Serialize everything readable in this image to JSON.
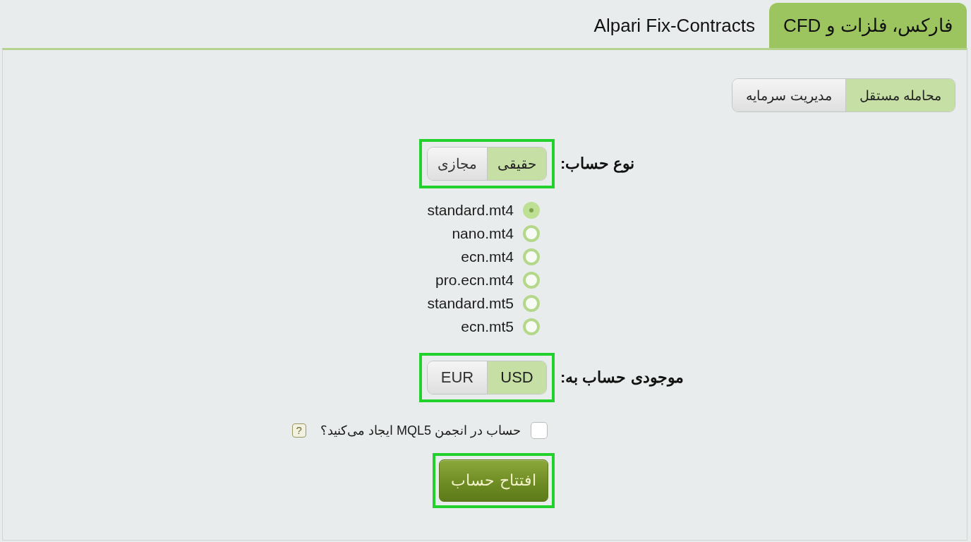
{
  "tabs": [
    {
      "label": "فارکس، فلزات و CFD",
      "selected": true
    },
    {
      "label": "Alpari Fix-Contracts",
      "selected": false
    }
  ],
  "mode_tabs": [
    {
      "label": "محامله مستقل",
      "selected": true
    },
    {
      "label": "مدیریت سرمایه",
      "selected": false
    }
  ],
  "account_type": {
    "label": "نوع حساب:",
    "highlighted": true,
    "options": [
      {
        "label": "حقیقی",
        "selected": true
      },
      {
        "label": "مجازی",
        "selected": false
      }
    ]
  },
  "servers": [
    {
      "label": "standard.mt4",
      "selected": true
    },
    {
      "label": "nano.mt4",
      "selected": false
    },
    {
      "label": "ecn.mt4",
      "selected": false
    },
    {
      "label": "pro.ecn.mt4",
      "selected": false
    },
    {
      "label": "standard.mt5",
      "selected": false
    },
    {
      "label": "ecn.mt5",
      "selected": false
    }
  ],
  "currency": {
    "label": "موجودی حساب به:",
    "highlighted": true,
    "options": [
      {
        "label": "USD",
        "selected": true
      },
      {
        "label": "EUR",
        "selected": false
      }
    ]
  },
  "mql5_checkbox": {
    "label": "حساب در انجمن MQL5 ایجاد می‌کنید؟",
    "checked": false,
    "help": "?"
  },
  "submit": {
    "label": "افتتاح حساب",
    "highlighted": true
  }
}
